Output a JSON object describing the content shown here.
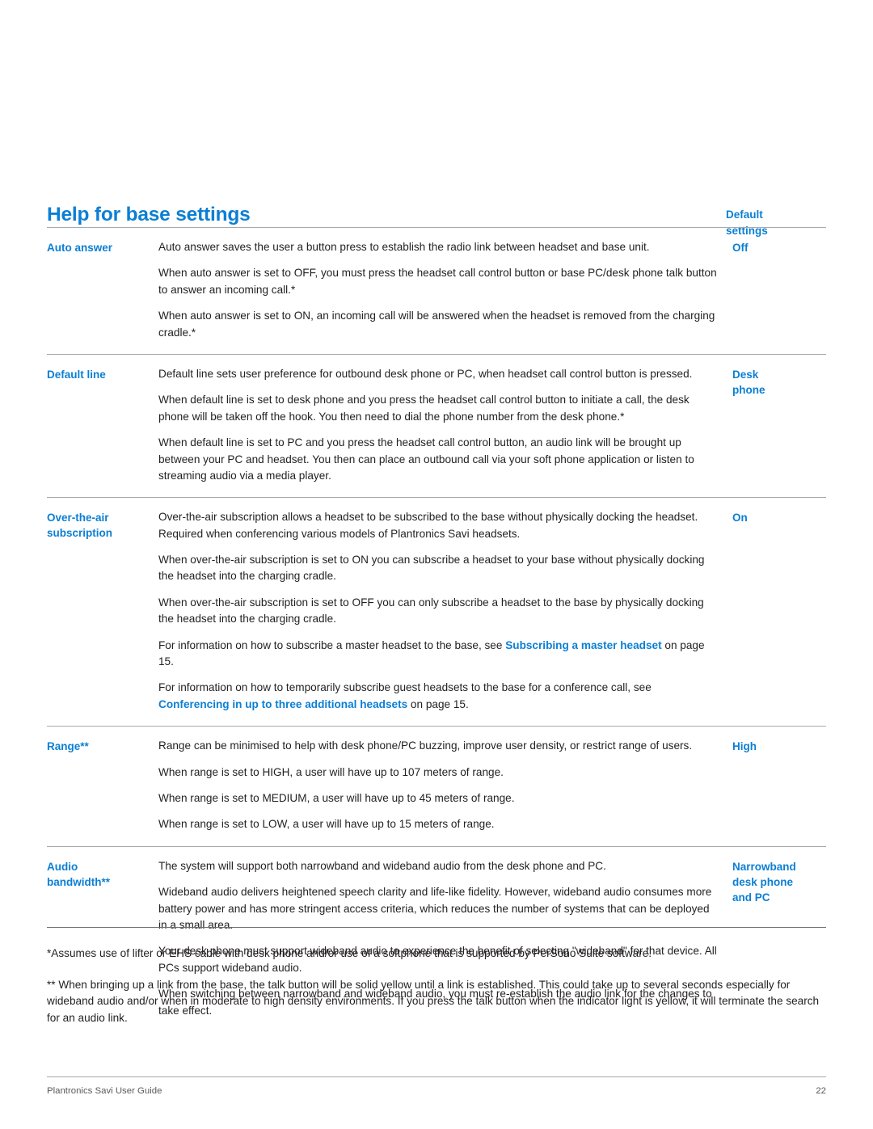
{
  "document": {
    "title": "Help for base settings",
    "value_column_header": [
      "Default",
      "settings"
    ],
    "accent_color": "#0b7fd4",
    "text_color": "#231f20",
    "rule_color": "#a7a9ac"
  },
  "rows": [
    {
      "label": [
        "Auto answer"
      ],
      "value": [
        "Off"
      ],
      "paragraphs": [
        {
          "text": "Auto answer saves the user a button press to establish the radio link between headset and base unit."
        },
        {
          "text": "When auto answer is set to OFF, you must press the headset call control button or base PC/desk phone talk button to answer an incoming call.*"
        },
        {
          "text": "When auto answer is set to ON, an incoming call will be answered when the headset is removed from the charging cradle.*"
        }
      ]
    },
    {
      "label": [
        "Default line"
      ],
      "value": [
        "Desk",
        "phone"
      ],
      "paragraphs": [
        {
          "text": "Default line sets user preference for outbound desk phone or PC, when headset call control button is pressed."
        },
        {
          "text": "When default line is set to desk phone and you press the headset call control button to initiate a call, the desk phone will be taken off the hook. You then need to dial the phone number from the desk phone.*"
        },
        {
          "text": "When default line is set to PC and you press the headset call control button, an audio link will be brought up between your PC and headset. You then can place an outbound call via your soft phone application or listen to streaming audio via a media player."
        }
      ]
    },
    {
      "label": [
        "Over-the-air",
        "subscription"
      ],
      "value": [
        "On"
      ],
      "paragraphs": [
        {
          "text": "Over-the-air subscription allows a headset to be subscribed to the base without physically docking the headset. Required when conferencing various models of Plantronics Savi  headsets."
        },
        {
          "text": "When over-the-air subscription is set to ON you can subscribe a headset to your base without physically docking the headset into the charging cradle."
        },
        {
          "text": "When over-the-air subscription is set to OFF you can only subscribe a headset to the base by physically docking the headset into the charging cradle."
        },
        {
          "prefix": "For information on how to subscribe a master headset to the base, see ",
          "link": "Subscribing a master headset",
          "suffix": " on page 15."
        },
        {
          "prefix": "For information on how to temporarily subscribe guest headsets to the base for a conference call, see ",
          "link": "Conferencing in up to three additional headsets",
          "suffix": " on page 15."
        }
      ]
    },
    {
      "label": [
        "Range**"
      ],
      "value": [
        "High"
      ],
      "paragraphs": [
        {
          "text": "Range can be minimised to help with desk phone/PC buzzing, improve user density, or restrict range of users."
        },
        {
          "text": "When range is set to HIGH, a user will have up to 107 meters of range."
        },
        {
          "text": "When range is set to MEDIUM, a user will have up to 45 meters of range."
        },
        {
          "text": "When range is set to LOW, a user will have up to 15 meters of range."
        }
      ]
    },
    {
      "label": [
        "Audio",
        "bandwidth**"
      ],
      "value": [
        "Narrowband",
        "desk phone",
        "and PC"
      ],
      "paragraphs": [
        {
          "text": "The system will support both narrowband and wideband audio from the desk phone and PC."
        },
        {
          "text": "Wideband audio delivers heightened speech clarity and life-like fidelity. However, wideband audio consumes more battery power and has more stringent access criteria, which reduces the number of systems that can be deployed in a small area."
        },
        {
          "text": "Your desk phone must support wideband audio to experience the benefit of selecting \"wideband\" for that device. All PCs support wideband audio."
        },
        {
          "text": "When switching between narrowband and wideband audio, you must re-establish the audio link for the changes to take effect."
        }
      ]
    }
  ],
  "footnotes": [
    "*Assumes use of lifter or EHS cable with desk phone and/or use of a softphone that is supported by PerSono Suite software.",
    "** When bringing up a link from the base, the talk button will be solid yellow until a link is established. This could take up to several seconds especially for wideband audio and/or when in moderate to high density environments. If you press the talk button when the indicator light is yellow, it will terminate the search for an audio link."
  ],
  "footer": {
    "guide_name": "Plantronics Savi User Guide",
    "page_number": "22"
  }
}
